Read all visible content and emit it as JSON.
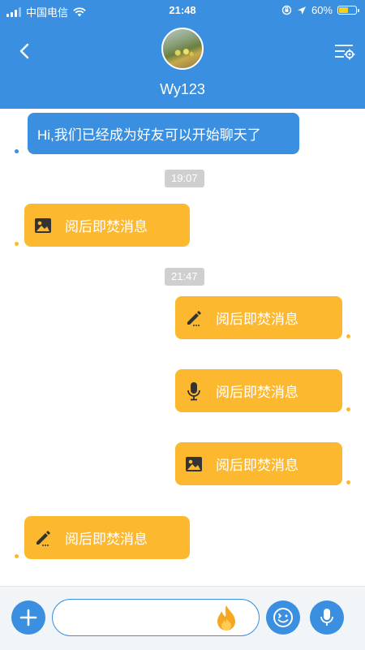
{
  "status_bar": {
    "carrier": "中国电信",
    "time": "21:48",
    "battery": "60%",
    "battery_level": 0.6
  },
  "header": {
    "title": "Wy123",
    "icons": {
      "back": "chevron-left-icon",
      "settings": "settings-sliders-icon",
      "avatar": "contact-avatar"
    }
  },
  "messages": [
    {
      "side": "left",
      "type": "text",
      "text": "Hi,我们已经成为好友可以开始聊天了"
    },
    {
      "type": "timestamp",
      "text": "19:07"
    },
    {
      "side": "left",
      "type": "burn",
      "icon": "image-icon",
      "text": "阅后即焚消息"
    },
    {
      "type": "timestamp",
      "text": "21:47"
    },
    {
      "side": "right",
      "type": "burn",
      "icon": "pencil-icon",
      "text": "阅后即焚消息"
    },
    {
      "side": "right",
      "type": "burn",
      "icon": "microphone-icon",
      "text": "阅后即焚消息"
    },
    {
      "side": "right",
      "type": "burn",
      "icon": "image-icon",
      "text": "阅后即焚消息"
    },
    {
      "side": "left",
      "type": "burn",
      "icon": "pencil-icon",
      "text": "阅后即焚消息"
    }
  ],
  "input": {
    "value": "",
    "placeholder": ""
  },
  "toolbar_icons": [
    "plus-icon",
    "fire-icon",
    "emoji-icon",
    "microphone-icon"
  ],
  "colors": {
    "primary": "#3a8fe0",
    "burn_bubble": "#fcb92f",
    "timestamp_bg": "#cfcfcf",
    "fire": "#f5a623"
  }
}
